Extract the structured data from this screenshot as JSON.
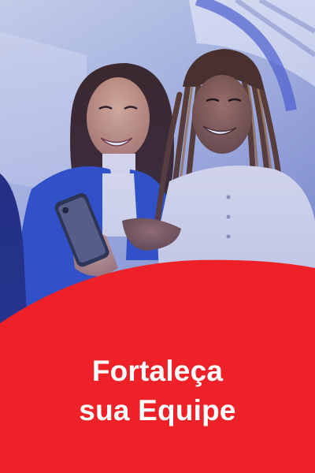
{
  "banner": {
    "headline_line1": "Fortaleça",
    "headline_line2": "sua Equipe"
  },
  "photo": {
    "description_icon": "two-women-looking-at-phone-photo"
  },
  "colors": {
    "brand_red": "#ee2128",
    "brand_blue": "#2a3a9c",
    "overlay_blue": "#3b4cc0"
  }
}
